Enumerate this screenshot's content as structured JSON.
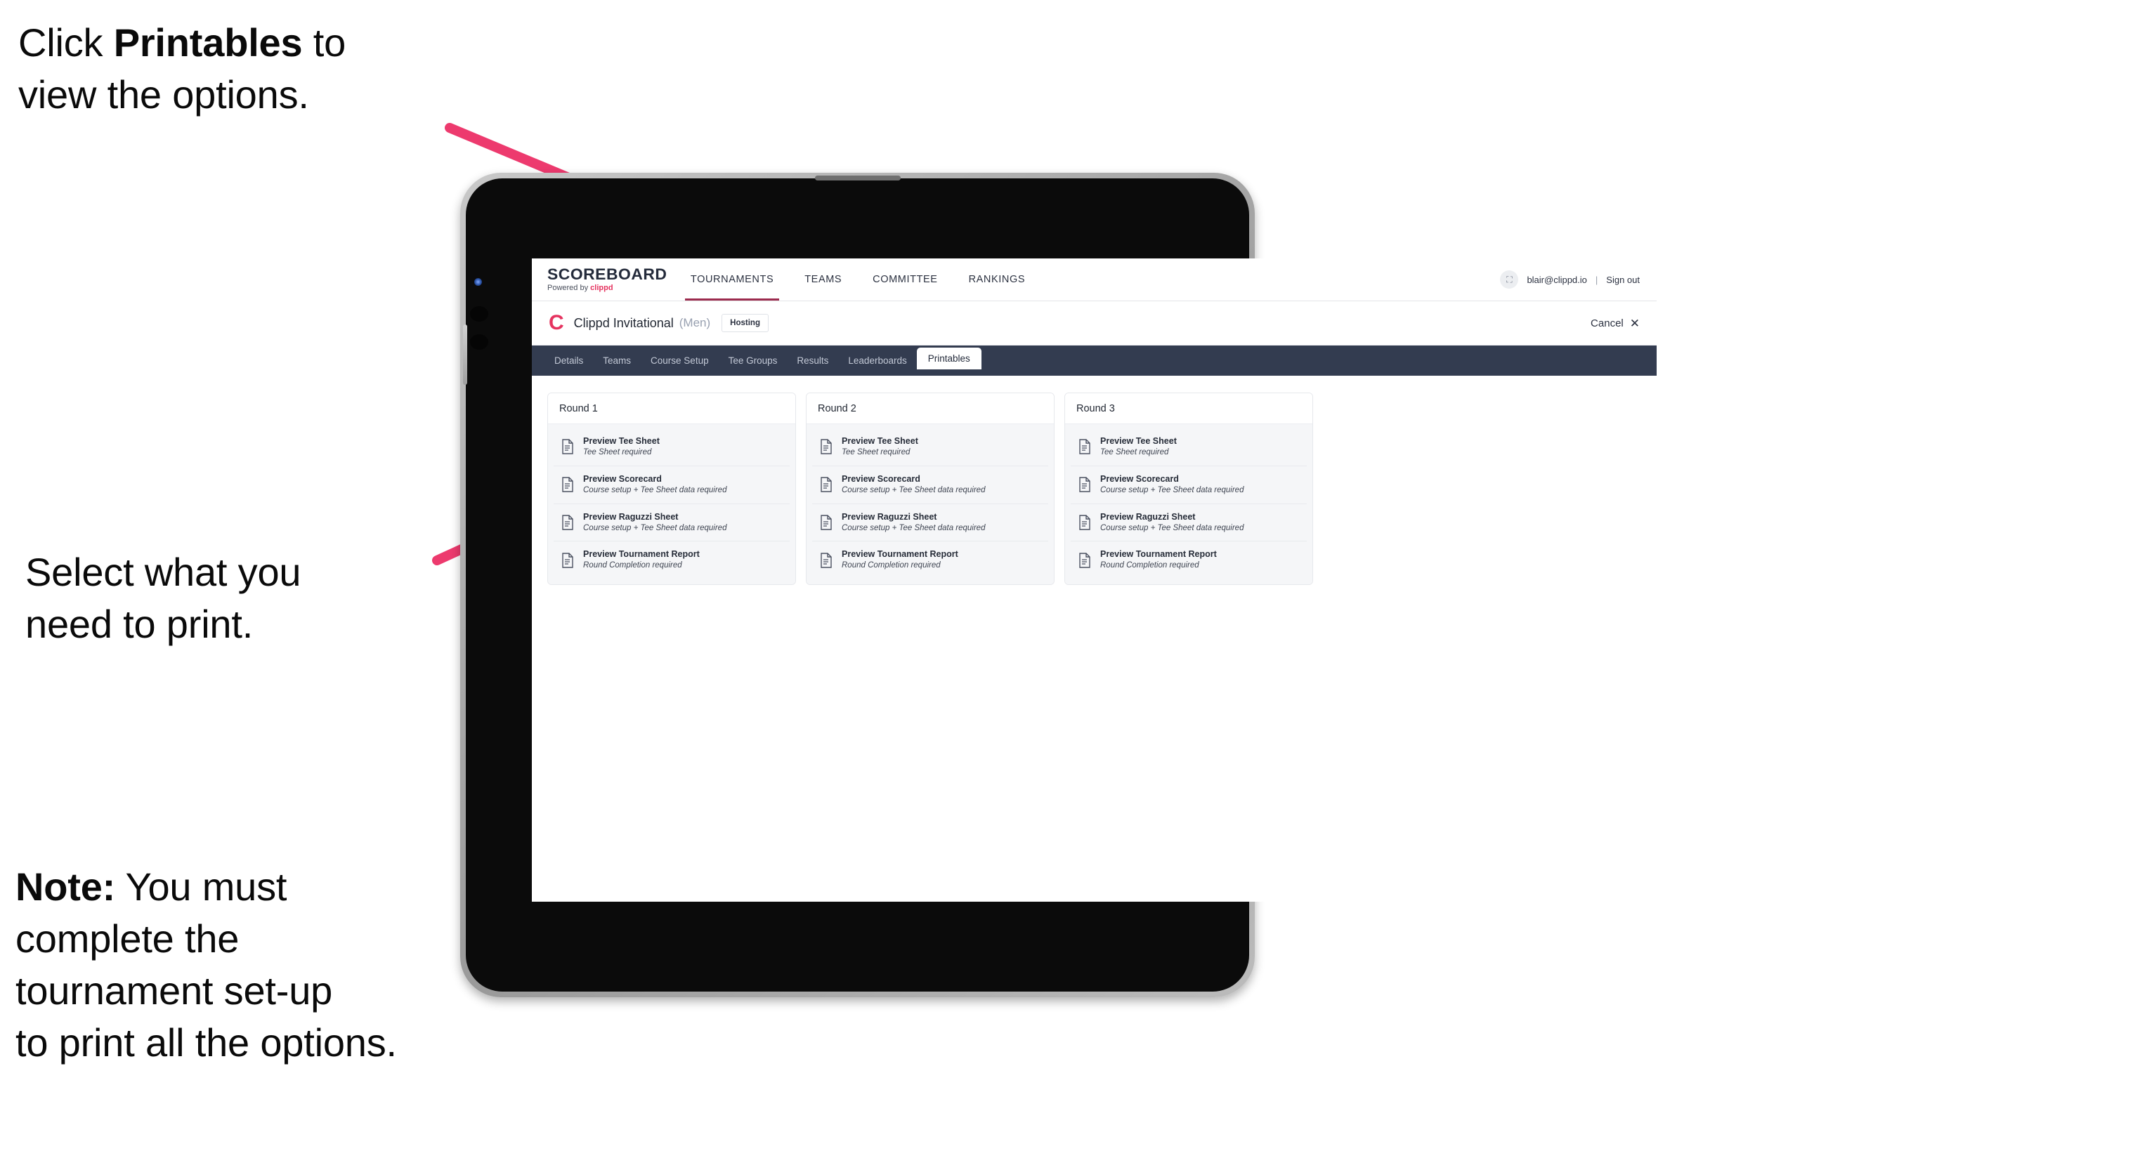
{
  "annotations": [
    {
      "id": "a1",
      "text_before": "Click ",
      "bold": "Printables",
      "text_after": " to\nview the options."
    },
    {
      "id": "a2",
      "text_before": "Select what you\n need to print.",
      "bold": "",
      "text_after": ""
    },
    {
      "id": "a3",
      "text_before": "",
      "bold": "Note:",
      "text_after": " You must\ncomplete the\ntournament set-up\nto print all the options."
    }
  ],
  "colors": {
    "arrow_pink": "#ED3A6E",
    "brand_pink": "#E5335F",
    "tabstrip_dark": "#333C50",
    "nav_underline": "#9C2B4E"
  },
  "app": {
    "brand": {
      "word": "SCOREBOARD",
      "powered_prefix": "Powered by ",
      "powered_name": "clippd"
    },
    "topnav": {
      "items": [
        {
          "label": "TOURNAMENTS",
          "active": true
        },
        {
          "label": "TEAMS",
          "active": false
        },
        {
          "label": "COMMITTEE",
          "active": false
        },
        {
          "label": "RANKINGS",
          "active": false
        }
      ],
      "avatar_glyph": "⛶",
      "user_email": "blair@clippd.io",
      "separator": "|",
      "sign_out": "Sign out"
    },
    "tournament_bar": {
      "logo_letter": "C",
      "title": "Clippd Invitational",
      "gender": "(Men)",
      "badge": "Hosting",
      "cancel_label": "Cancel",
      "cancel_icon": "✕"
    },
    "tabs": [
      {
        "label": "Details",
        "active": false
      },
      {
        "label": "Teams",
        "active": false
      },
      {
        "label": "Course Setup",
        "active": false
      },
      {
        "label": "Tee Groups",
        "active": false
      },
      {
        "label": "Results",
        "active": false
      },
      {
        "label": "Leaderboards",
        "active": false
      },
      {
        "label": "Printables",
        "active": true
      }
    ],
    "rounds": [
      {
        "title": "Round 1",
        "items": [
          {
            "title": "Preview Tee Sheet",
            "sub": "Tee Sheet required"
          },
          {
            "title": "Preview Scorecard",
            "sub": "Course setup + Tee Sheet data required"
          },
          {
            "title": "Preview Raguzzi Sheet",
            "sub": "Course setup + Tee Sheet data required"
          },
          {
            "title": "Preview Tournament Report",
            "sub": "Round Completion required"
          }
        ]
      },
      {
        "title": "Round 2",
        "items": [
          {
            "title": "Preview Tee Sheet",
            "sub": "Tee Sheet required"
          },
          {
            "title": "Preview Scorecard",
            "sub": "Course setup + Tee Sheet data required"
          },
          {
            "title": "Preview Raguzzi Sheet",
            "sub": "Course setup + Tee Sheet data required"
          },
          {
            "title": "Preview Tournament Report",
            "sub": "Round Completion required"
          }
        ]
      },
      {
        "title": "Round 3",
        "items": [
          {
            "title": "Preview Tee Sheet",
            "sub": "Tee Sheet required"
          },
          {
            "title": "Preview Scorecard",
            "sub": "Course setup + Tee Sheet data required"
          },
          {
            "title": "Preview Raguzzi Sheet",
            "sub": "Course setup + Tee Sheet data required"
          },
          {
            "title": "Preview Tournament Report",
            "sub": "Round Completion required"
          }
        ]
      }
    ]
  }
}
